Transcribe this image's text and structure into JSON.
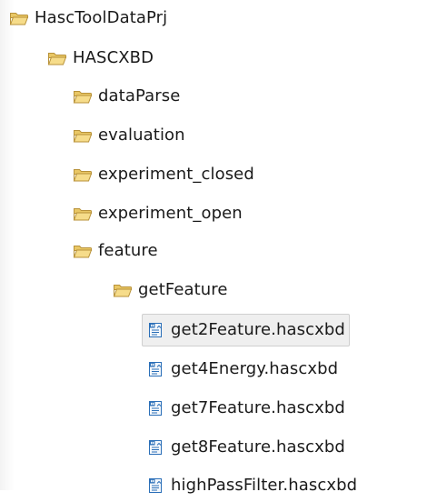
{
  "tree": {
    "items": [
      {
        "label": "HascToolDataPrj",
        "icon": "open-folder-icon",
        "type": "folder",
        "level": 0
      },
      {
        "label": "HASCXBD",
        "icon": "open-folder-icon",
        "type": "folder",
        "level": 1
      },
      {
        "label": "dataParse",
        "icon": "open-folder-icon",
        "type": "folder",
        "level": 2
      },
      {
        "label": "evaluation",
        "icon": "open-folder-icon",
        "type": "folder",
        "level": 2
      },
      {
        "label": "experiment_closed",
        "icon": "open-folder-icon",
        "type": "folder",
        "level": 2
      },
      {
        "label": "experiment_open",
        "icon": "open-folder-icon",
        "type": "folder",
        "level": 2
      },
      {
        "label": "feature",
        "icon": "open-folder-icon",
        "type": "folder",
        "level": 2
      },
      {
        "label": "getFeature",
        "icon": "open-folder-icon",
        "type": "folder",
        "level": 3
      },
      {
        "label": "get2Feature.hascxbd",
        "icon": "hascxbd-file-icon",
        "type": "file",
        "level": 4,
        "selected": true
      },
      {
        "label": "get4Energy.hascxbd",
        "icon": "hascxbd-file-icon",
        "type": "file",
        "level": 4
      },
      {
        "label": "get7Feature.hascxbd",
        "icon": "hascxbd-file-icon",
        "type": "file",
        "level": 4
      },
      {
        "label": "get8Feature.hascxbd",
        "icon": "hascxbd-file-icon",
        "type": "file",
        "level": 4
      },
      {
        "label": "highPassFilter.hascxbd",
        "icon": "hascxbd-file-icon",
        "type": "file",
        "level": 4
      }
    ]
  },
  "colors": {
    "folder_fill": "#f6dc8a",
    "folder_stroke": "#b8923a",
    "folder_back": "#e9c765",
    "file_blue": "#2b6fb8",
    "file_paper": "#f4f8fc",
    "selection_bg": "#efefef",
    "selection_border": "#cfcfcf"
  }
}
